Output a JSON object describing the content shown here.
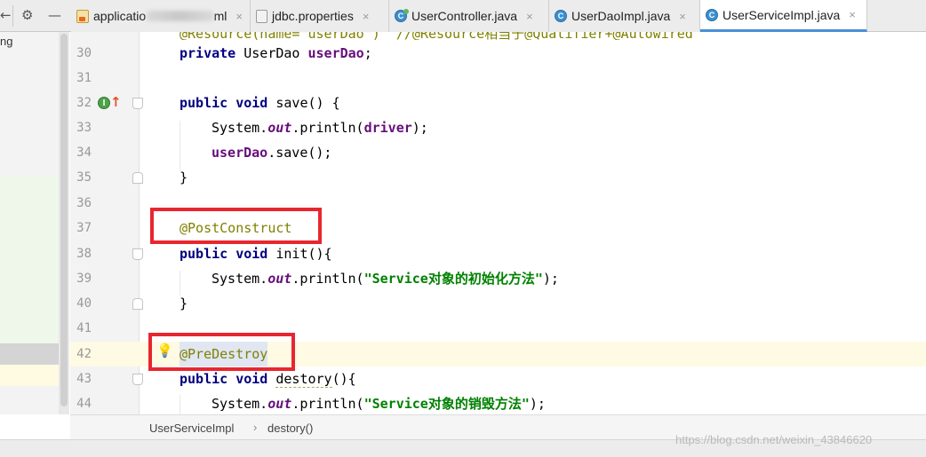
{
  "toolbar": {
    "collapse_icon": "minus",
    "settings_icon": "gear",
    "partial_icon": "arrow-left-partial"
  },
  "tabs": [
    {
      "label_visible_start": "applicatio",
      "label_visible_end": "ml",
      "icon": "spring-xml-icon",
      "close": "×"
    },
    {
      "label": "jdbc.properties",
      "icon": "properties-file-icon",
      "close": "×"
    },
    {
      "label": "UserController.java",
      "icon": "java-class-icon",
      "close": "×"
    },
    {
      "label": "UserDaoImpl.java",
      "icon": "java-class-icon",
      "close": "×"
    },
    {
      "label": "UserServiceImpl.java",
      "icon": "java-class-icon",
      "close": "×",
      "active": true
    }
  ],
  "project_panel": {
    "visible_fragment": "ng"
  },
  "editor": {
    "cutoff_line": "@Resource(name=\"userDao\")  //@Resource相当于@Qualifier+@Autowired",
    "lines": [
      {
        "n": "30"
      },
      {
        "n": "31"
      },
      {
        "n": "32"
      },
      {
        "n": "33"
      },
      {
        "n": "34"
      },
      {
        "n": "35"
      },
      {
        "n": "36"
      },
      {
        "n": "37"
      },
      {
        "n": "38"
      },
      {
        "n": "39"
      },
      {
        "n": "40"
      },
      {
        "n": "41"
      },
      {
        "n": "42"
      },
      {
        "n": "43"
      },
      {
        "n": "44"
      }
    ],
    "tokens": {
      "private": "private",
      "public": "public",
      "void": "void",
      "type_userdao": "UserDao",
      "field_userdao": "userDao",
      "semicolon": ";",
      "save_sig": "save() {",
      "system": "System.",
      "out": "out",
      "println_open": ".println(",
      "driver": "driver",
      "close_paren_semi": ");",
      "userdao_call": "userDao",
      "save_call": ".save();",
      "brace_close": "}",
      "post_construct": "@PostConstruct",
      "init_sig": "init(){",
      "str_init": "\"Service对象的初始化方法\"",
      "pre_destroy": "@PreDestroy",
      "destory_name": "destory",
      "destory_sig_rest": "(){",
      "str_destroy": "\"Service对象的销毁方法\""
    }
  },
  "breadcrumb": {
    "class": "UserServiceImpl",
    "separator": "›",
    "method": "destory()"
  },
  "watermark": "https://blog.csdn.net/weixin_43846620",
  "colors": {
    "highlight_box": "#e8262f",
    "keyword": "#000080",
    "annotation": "#808000",
    "string": "#008000",
    "field": "#660e7a",
    "current_line": "#fffae3",
    "active_tab_underline": "#4a8fd6"
  }
}
